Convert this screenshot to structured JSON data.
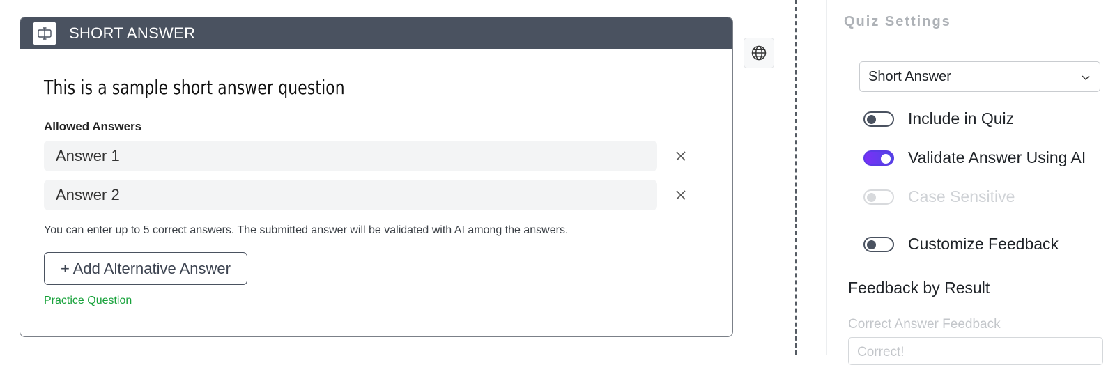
{
  "question": {
    "type_label": "SHORT ANSWER",
    "type_icon": "text-cursor-icon",
    "title": "This is a sample short answer question",
    "allowed_answers_label": "Allowed Answers",
    "answers": [
      "Answer 1",
      "Answer 2"
    ],
    "hint": "You can enter up to 5 correct answers. The submitted answer will be validated with AI among the answers.",
    "add_button_label": "+ Add Alternative Answer",
    "practice_label": "Practice Question"
  },
  "translate_button_icon": "globe-icon",
  "settings": {
    "title": "Quiz Settings",
    "question_type_selected": "Short Answer",
    "toggles": [
      {
        "label": "Include in Quiz",
        "state": "off"
      },
      {
        "label": "Validate Answer Using AI",
        "state": "on"
      },
      {
        "label": "Case Sensitive",
        "state": "disabled"
      },
      {
        "label": "Customize Feedback",
        "state": "off"
      }
    ],
    "feedback_section_title": "Feedback by Result",
    "correct_feedback_label": "Correct Answer Feedback",
    "correct_feedback_value": "Correct!"
  },
  "colors": {
    "header_bg": "#4a5260",
    "practice_green": "#18a23b",
    "toggle_on_start": "#7b2ff7",
    "toggle_on_end": "#4f46e5"
  }
}
